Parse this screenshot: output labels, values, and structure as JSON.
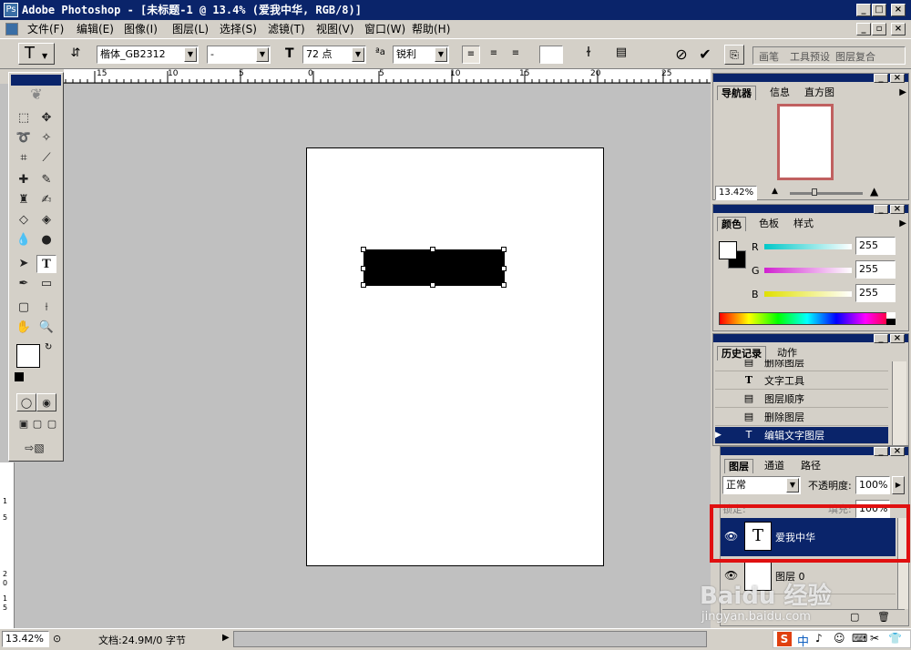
{
  "app": {
    "title": "Adobe Photoshop - [未标题-1 @ 13.4% (爱我中华, RGB/8)]",
    "min": "_",
    "max": "□",
    "close": "×",
    "doc_min": "_",
    "doc_restore": "▫",
    "doc_close": "×"
  },
  "menu": [
    {
      "label": "文件(F)"
    },
    {
      "label": "编辑(E)"
    },
    {
      "label": "图像(I)"
    },
    {
      "label": "图层(L)"
    },
    {
      "label": "选择(S)"
    },
    {
      "label": "滤镜(T)"
    },
    {
      "label": "视图(V)"
    },
    {
      "label": "窗口(W)"
    },
    {
      "label": "帮助(H)"
    }
  ],
  "options": {
    "font_family": "楷体_GB2312",
    "font_style": "-",
    "font_size": "72 点",
    "antialias": "锐利",
    "cancel": "⊘",
    "commit": "✔",
    "tabs": [
      "画笔",
      "工具预设",
      "图层复合"
    ]
  },
  "ruler": {
    "top_labels": [
      "15",
      "10",
      "5",
      "0",
      "5",
      "10",
      "15",
      "20",
      "25"
    ],
    "left_labels": [
      "1",
      "5",
      "2",
      "0",
      "1",
      "5"
    ]
  },
  "navigator": {
    "tabs": [
      "导航器",
      "信息",
      "直方图"
    ],
    "zoom": "13.42%"
  },
  "color": {
    "tabs": [
      "颜色",
      "色板",
      "样式"
    ],
    "channels": [
      {
        "label": "R",
        "value": "255"
      },
      {
        "label": "G",
        "value": "255"
      },
      {
        "label": "B",
        "value": "255"
      }
    ],
    "colors": {
      "r": "#00c8c8",
      "g": "#d020d0",
      "b": "#e0e000"
    }
  },
  "history": {
    "tabs": [
      "历史记录",
      "动作"
    ],
    "items": [
      {
        "label": "删除图层"
      },
      {
        "label": "文字工具"
      },
      {
        "label": "图层顺序"
      },
      {
        "label": "删除图层"
      },
      {
        "label": "编辑文字图层"
      }
    ]
  },
  "layers": {
    "tabs": [
      "图层",
      "通道",
      "路径"
    ],
    "blend_mode": "正常",
    "opacity_label": "不透明度:",
    "opacity": "100%",
    "lock_label": "锁定:",
    "fill_label": "填充:",
    "fill": "100%",
    "items": [
      {
        "name": "爱我中华",
        "thumb": "T"
      },
      {
        "name": "图层 0"
      }
    ]
  },
  "status": {
    "zoom": "13.42%",
    "doc_info": "文档:24.9M/0 字节"
  },
  "watermark": {
    "brand": "Baidu 经验",
    "url": "jingyan.baidu.com"
  },
  "ime": {
    "items": [
      "S",
      "中",
      "♪",
      "☺",
      "⌨",
      "✂",
      "👕"
    ]
  }
}
